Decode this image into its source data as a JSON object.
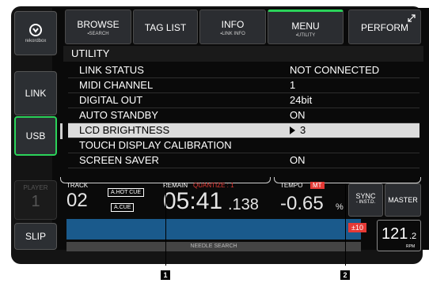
{
  "sidebar": {
    "logo_text": "rekordbox",
    "link_label": "LINK",
    "usb_label": "USB",
    "player_label": "PLAYER",
    "player_number": "1",
    "slip_label": "SLIP"
  },
  "tabs": [
    {
      "label": "BROWSE",
      "sub": "▪SEARCH"
    },
    {
      "label": "TAG LIST",
      "sub": ""
    },
    {
      "label": "INFO",
      "sub": "▪LINK INFO"
    },
    {
      "label": "MENU",
      "sub": "▪UTILITY"
    },
    {
      "label": "PERFORM",
      "sub": ""
    }
  ],
  "utility": {
    "title": "UTILITY",
    "rows": [
      {
        "label": "LINK STATUS",
        "value": "NOT CONNECTED"
      },
      {
        "label": "MIDI CHANNEL",
        "value": "1"
      },
      {
        "label": "DIGITAL OUT",
        "value": "24bit"
      },
      {
        "label": "AUTO STANDBY",
        "value": "ON"
      },
      {
        "label": "LCD BRIGHTNESS",
        "value": "3"
      },
      {
        "label": "TOUCH DISPLAY CALIBRATION",
        "value": ""
      },
      {
        "label": "SCREEN SAVER",
        "value": "ON"
      }
    ]
  },
  "deck": {
    "track_label": "TRACK",
    "track_number": "02",
    "hotcue_label": "A.HOT CUE",
    "acue_label": "A.CUE",
    "remain_label": "REMAIN",
    "quantize_label": "QUANTIZE : 1",
    "time_main": "05:41",
    "time_frac": ".138",
    "tempo_label": "TEMPO",
    "tempo_mt": "MT",
    "tempo_value": "-0.65",
    "tempo_unit": "%",
    "needle_label": "NEEDLE SEARCH",
    "sync_label": "SYNC",
    "sync_sub": "- INST.D.",
    "master_label": "MASTER",
    "range_label": "±10",
    "bpm_int": "121",
    "bpm_frac": ".2",
    "bpm_unit": "RPM"
  },
  "callouts": {
    "one": "1",
    "two": "2"
  },
  "colors": {
    "accent": "#2bd35a",
    "waveform": "#1a5a8c",
    "alert": "#e53935"
  }
}
